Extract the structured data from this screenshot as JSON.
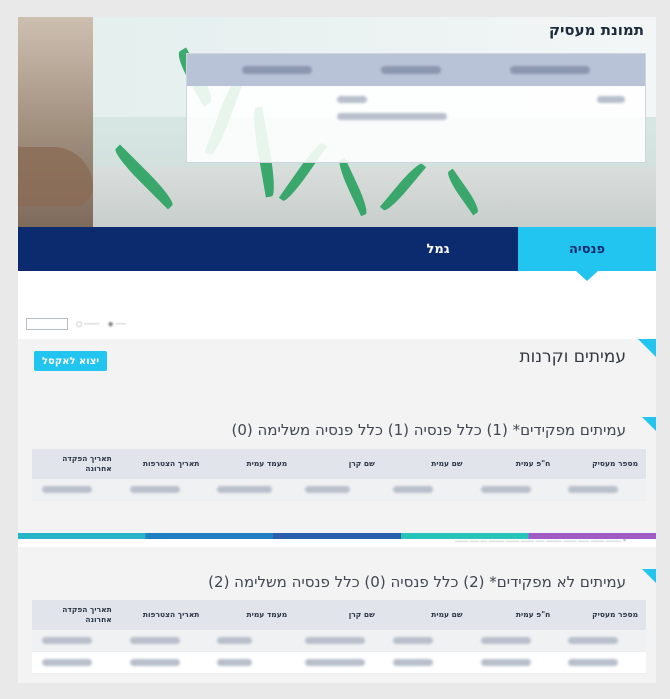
{
  "header": {
    "title": "תמונת מעסיק"
  },
  "tabs": [
    {
      "label": "פנסיה",
      "active": true
    },
    {
      "label": "גמל",
      "active": false
    }
  ],
  "main": {
    "title": "עמיתים וקרנות",
    "back_button": "יצוא לאקסל"
  },
  "table_headers": [
    "מספר מעסיק",
    "ח\"פ עמית",
    "שם עמית",
    "שם קרן",
    "מעמד עמית",
    "תאריך הצטרפות",
    "תאריך הפקדה אחרונה"
  ],
  "section1": {
    "title": "עמיתים מפקידים* (1) כלל פנסיה (1) כלל פנסיה משלימה (0)",
    "rows": 1
  },
  "section2": {
    "title": "עמיתים לא מפקידים* (2) כלל פנסיה (0) כלל פנסיה משלימה (2)",
    "rows": 2
  },
  "colors": {
    "navy": "#0b2b6e",
    "cyan": "#22c4f0"
  }
}
